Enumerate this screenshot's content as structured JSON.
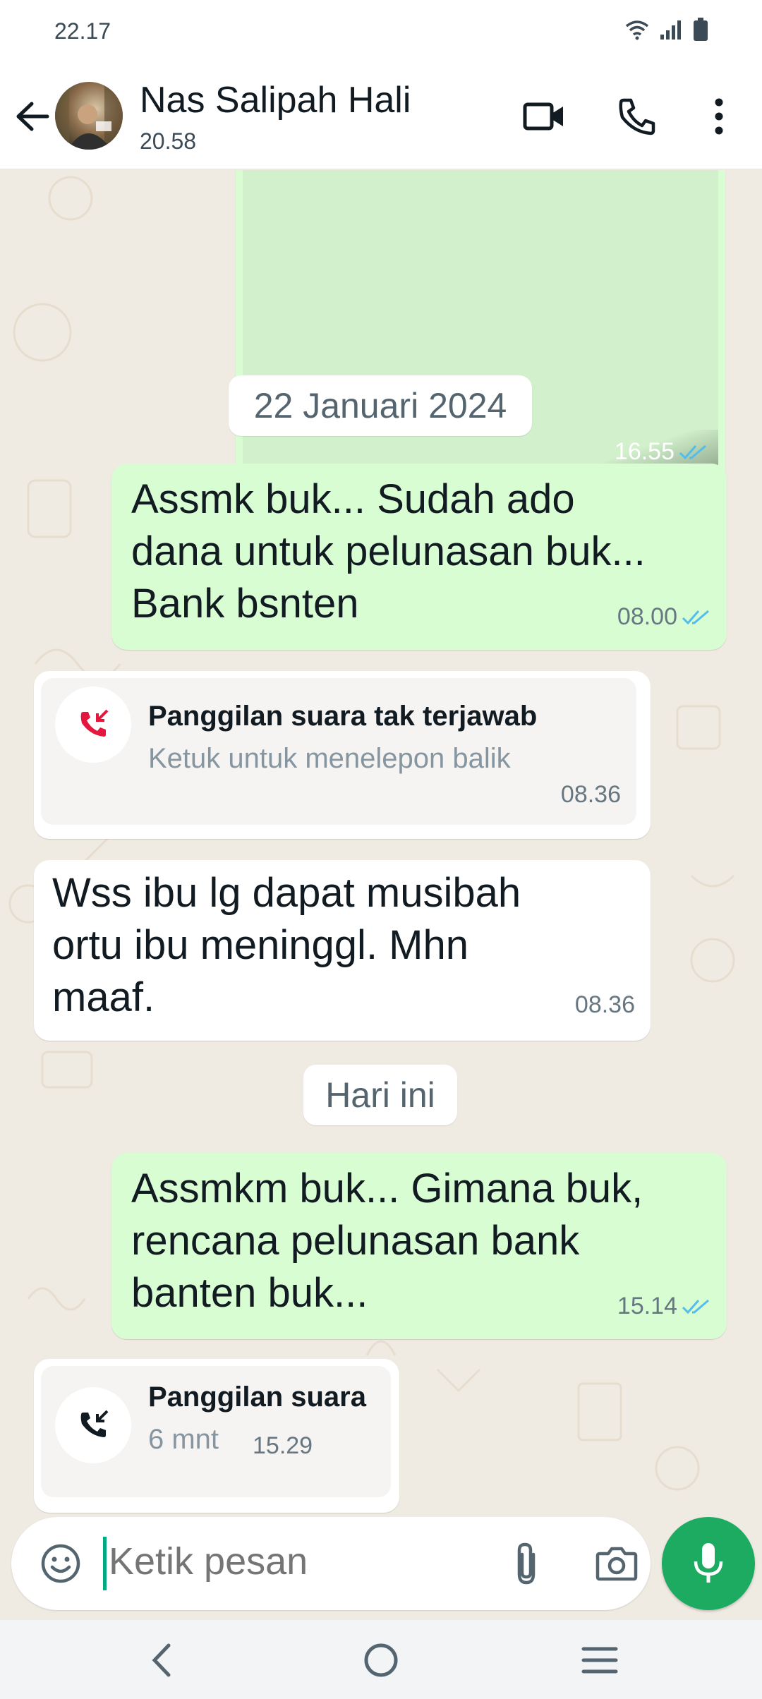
{
  "status_bar": {
    "time": "22.17",
    "icons": [
      "wifi-icon",
      "signal-icon",
      "battery-icon"
    ]
  },
  "header": {
    "contact_name": "Nas Salipah Hali",
    "subtitle": "20.58",
    "icons": [
      "back-arrow-icon",
      "video-call-icon",
      "voice-call-icon",
      "more-options-icon"
    ]
  },
  "messages": {
    "media_prev": {
      "time": "16.55",
      "status": "read"
    },
    "date_1": "22 Januari 2024",
    "msg_1": {
      "text": "Assmk buk... Sudah ado\ndana untuk pelunasan buk...\nBank bsnten",
      "time": "08.00",
      "status": "read"
    },
    "missed_call": {
      "title": "Panggilan suara tak terjawab",
      "subtitle": "Ketuk untuk menelepon balik",
      "time": "08.36"
    },
    "msg_2": {
      "text": "Wss ibu lg dapat musibah\nortu ibu meninggl. Mhn\nmaaf.",
      "time": "08.36"
    },
    "date_2": "Hari ini",
    "msg_3": {
      "text": "Assmkm buk... Gimana buk,\nrencana pelunasan bank\nbanten buk...",
      "time": "15.14",
      "status": "read"
    },
    "voice_call": {
      "title": "Panggilan suara",
      "duration": "6 mnt",
      "time": "15.29"
    }
  },
  "composer": {
    "placeholder": "Ketik pesan",
    "icons": [
      "emoji-icon",
      "attach-icon",
      "camera-icon",
      "mic-icon"
    ]
  },
  "colors": {
    "outgoing_bubble": "#d9fdd3",
    "incoming_bubble": "#ffffff",
    "chat_background": "#efeae2",
    "read_tick": "#53bdeb",
    "missed_call_red": "#e5173f",
    "accent_green": "#1daa61"
  }
}
